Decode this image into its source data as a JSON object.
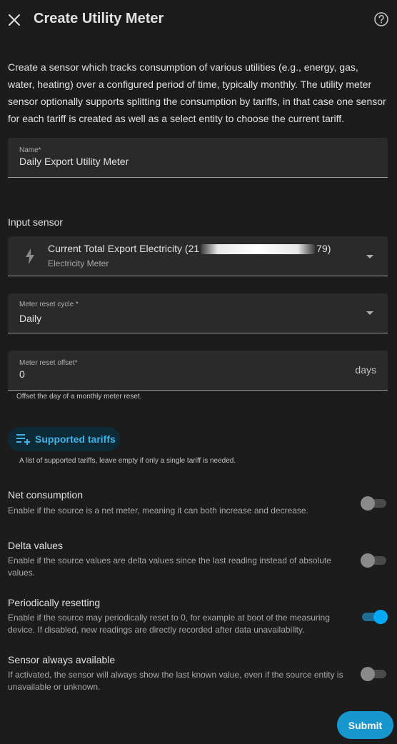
{
  "header": {
    "title": "Create Utility Meter",
    "close_icon": "close-icon",
    "help_icon": "help-circle-icon"
  },
  "description": "Create a sensor which tracks consumption of various utilities (e.g., energy, gas, water, heating) over a configured period of time, typically monthly. The utility meter sensor optionally supports splitting the consumption by tariffs, in that case one sensor for each tariff is created as well as a select entity to choose the current tariff.",
  "name_field": {
    "label": "Name*",
    "value": "Daily Export Utility Meter"
  },
  "input_sensor": {
    "section_label": "Input sensor",
    "entity_prefix": "Current Total Export Electricity (21",
    "entity_suffix": "79)",
    "subtitle": "Electricity Meter",
    "icon": "lightning-bolt-icon"
  },
  "reset_cycle": {
    "label": "Meter reset cycle *",
    "value": "Daily"
  },
  "reset_offset": {
    "label": "Meter reset offset*",
    "value": "0",
    "unit": "days",
    "helper": "Offset the day of a monthly meter reset."
  },
  "tariffs": {
    "button_label": "Supported tariffs",
    "icon": "playlist-plus-icon",
    "helper": "A list of supported tariffs, leave empty if only a single tariff is needed."
  },
  "options": [
    {
      "title": "Net consumption",
      "description": "Enable if the source is a net meter, meaning it can both increase and decrease.",
      "enabled": false
    },
    {
      "title": "Delta values",
      "description": "Enable if the source values are delta values since the last reading instead of absolute values.",
      "enabled": false
    },
    {
      "title": "Periodically resetting",
      "description": "Enable if the source may periodically reset to 0, for example at boot of the measuring device. If disabled, new readings are directly recorded after data unavailability.",
      "enabled": true
    },
    {
      "title": "Sensor always available",
      "description": "If activated, the sensor will always show the last known value, even if the source entity is unavailable or unknown.",
      "enabled": false
    }
  ],
  "submit_label": "Submit",
  "colors": {
    "background": "#1c1c1c",
    "accent": "#03a9f4",
    "field_bg": "#2a2a2a"
  }
}
